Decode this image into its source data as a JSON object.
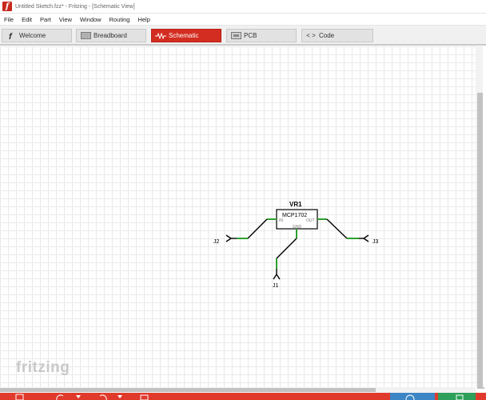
{
  "window": {
    "title": "Untitled Sketch.fzz* - Fritzing - [Schematic View]",
    "app_icon_letter": "f"
  },
  "menu": [
    "File",
    "Edit",
    "Part",
    "View",
    "Window",
    "Routing",
    "Help"
  ],
  "tabs": [
    {
      "label": "Welcome",
      "icon": "fritzing-f-icon"
    },
    {
      "label": "Breadboard",
      "icon": "breadboard-icon"
    },
    {
      "label": "Schematic",
      "icon": "resistor-zigzag-icon",
      "active": true
    },
    {
      "label": "PCB",
      "icon": "pcb-icon"
    },
    {
      "label": "Code",
      "icon": "code-brackets-icon"
    }
  ],
  "schematic": {
    "part_ref": "VR1",
    "part_name": "MCP1702",
    "pin_in": "IN",
    "pin_out": "OUT",
    "pin_gnd": "GND",
    "connectors": [
      "J2",
      "J3",
      "J1"
    ],
    "wire_color": "#2ea02e"
  },
  "watermark": "fritzing",
  "colors": {
    "accent": "#d32d21",
    "bottom_bar": "#e03a2c",
    "grid": "#e9e9e9"
  }
}
